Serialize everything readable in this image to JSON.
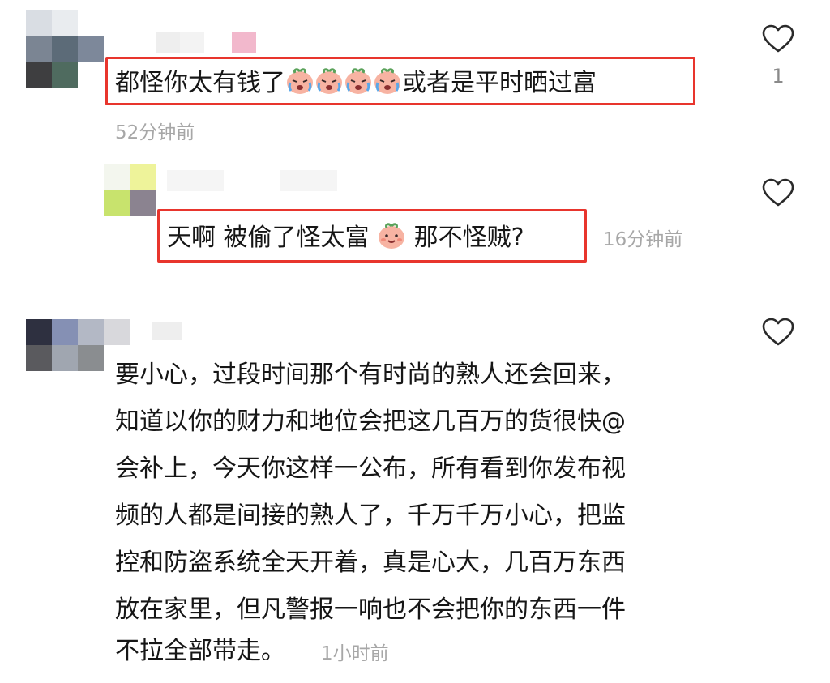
{
  "comments": [
    {
      "text_before": "都怪你太有钱了",
      "emoji": "crying-peach-emoji",
      "emoji_count": 4,
      "text_after": "或者是平时晒过富",
      "time": "52分钟前",
      "likes": "1"
    },
    {
      "text_before": "天啊 被偷了怪太富",
      "emoji": "smiling-peach-emoji",
      "text_after": "那不怪贼?",
      "time": "16分钟前"
    },
    {
      "lines": [
        "要小心，过段时间那个有时尚的熟人还会回来，",
        "知道以你的财力和地位会把这几百万的货很快@",
        "会补上，今天你这样一公布，所有看到你发布视",
        "频的人都是间接的熟人了，千万千万小心，把监",
        "控和防盗系统全天开着，真是心大，几百万东西",
        "放在家里，但凡警报一响也不会把你的东西一件",
        "不拉全部带走。"
      ],
      "time": "1小时前"
    }
  ],
  "colors": {
    "highlight": "#e8352d",
    "timestamp": "#a7a7a7",
    "text": "#161616"
  }
}
